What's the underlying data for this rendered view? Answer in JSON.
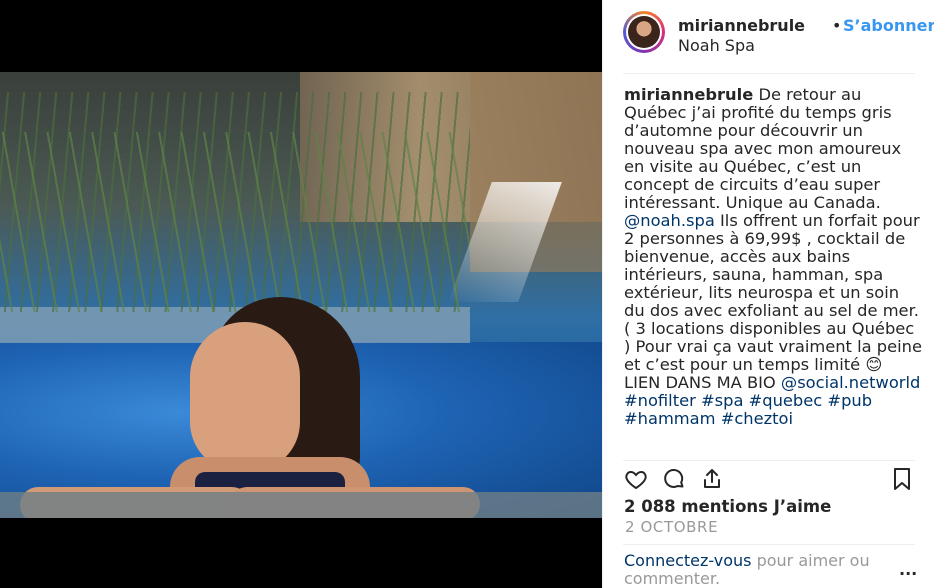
{
  "post": {
    "username": "mirianne​brule",
    "follow_label": "S’abonner",
    "separator": "•",
    "location": "Noah Spa"
  },
  "caption": {
    "username": "mirianne​brule",
    "text1": " De retour au Québec j’ai profité du temps gris d’automne pour découvrir un nouveau spa avec mon amoureux en visite au Québec, c’est un concept de circuits d’eau super intéressant. Unique au Canada. ",
    "mention1": "@noah.spa",
    "text2": " Ils offrent un forfait pour 2 personnes à 69,99$ , cocktail de bienvenue, accès aux bains intérieurs, sauna, hamman, spa extérieur, lits neurospa et un soin du dos avec exfoliant au sel de mer. ( 3 locations disponibles au Québec ) Pour vrai ça vaut vraiment la peine et c’est pour un temps limité 😊 LIEN DANS MA BIO ",
    "mention2": "@social.networld",
    "tag1": "#nofilter",
    "tag2": "#spa",
    "tag3": "#quebec",
    "tag4": "#pub",
    "tag5": "#hammam",
    "tag6": "#cheztoi"
  },
  "actions": {
    "like_icon": "heart-icon",
    "comment_icon": "comment-icon",
    "share_icon": "share-icon",
    "save_icon": "bookmark-icon"
  },
  "stats": {
    "likes": "2 088 mentions J’aime",
    "date": "2 OCTOBRE"
  },
  "login_prompt": {
    "link": "Connectez-vous",
    "text": " pour aimer ou commenter.",
    "more": "..."
  },
  "colors": {
    "link_blue": "#3897f0",
    "hashtag": "#003569",
    "muted": "#999999"
  }
}
